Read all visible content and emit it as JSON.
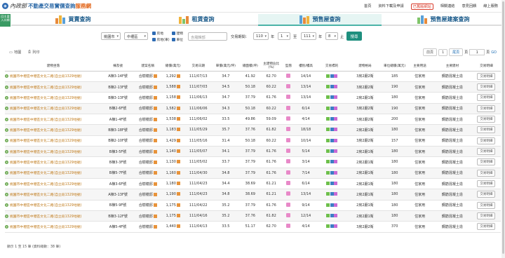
{
  "header": {
    "org": "內政部",
    "title_main": "不動產交易實價查詢",
    "title_accent": "服務網",
    "nav": [
      "首頁",
      "資料下載及申請",
      "已舊版網站",
      "相關連結",
      "意見回饋",
      "線上服務"
    ]
  },
  "sidetab": "回主要入口網",
  "tabs": [
    {
      "label": "買賣查詢",
      "active": false
    },
    {
      "label": "租賃查詢",
      "active": false
    },
    {
      "label": "預售屋查詢",
      "active": true
    },
    {
      "label": "預售屋建案查詢",
      "active": false
    }
  ],
  "search": {
    "city": "桃園市",
    "district": "中壢區",
    "checks": [
      "房地",
      "房地(車)",
      "建物",
      "車位"
    ],
    "keyword_placeholder": "含羅輯部",
    "period_label": "交易期間：",
    "from_year": "110",
    "year_unit": "年",
    "from_month": "1",
    "to_label": "至",
    "to_year": "111",
    "to_month": "8",
    "month_unit": "止",
    "submit": "搜尋"
  },
  "toolbar": {
    "map": "地圖",
    "print": "列印",
    "prev": "前頁",
    "next": "尾頁",
    "page_label": "頁",
    "page_value": "1",
    "page_total": "頁",
    "go": "GO"
  },
  "columns": [
    "建物坐落",
    "棟及號",
    "建案名稱",
    "總價(萬元)",
    "交易日期",
    "單價(萬元/坪)",
    "總面積(坪)",
    "主建物佔比(%)",
    "型態",
    "樓別/樓高",
    "交易標的",
    "建物格局",
    "車位總價(萬元)",
    "主要用途",
    "主要建材",
    "交易明細"
  ],
  "rows": [
    [
      "桃園市中壢區中壢區文化二路(自立段1329地號)",
      "A棟3-14F號",
      "合樹蘊邸",
      "1,292",
      "111/07/13",
      "34.7",
      "41.92",
      "62.70",
      "14/14",
      "3房2廳2衛",
      "185"
    ],
    [
      "桃園市中壢區中壢區文化二路(自立段1329地號)",
      "B棟2-13F號",
      "合樹蘊邸",
      "1,588",
      "111/07/03",
      "34.5",
      "50.18",
      "60.22",
      "13/14",
      "3房2廳2衛",
      "190"
    ],
    [
      "桃園市中壢區中壢區文化二路(自立段1329地號)",
      "B棟3-13F號",
      "合樹蘊邸",
      "1,158",
      "111/06/13",
      "34.7",
      "37.79",
      "61.76",
      "13/14",
      "2房2廳1衛",
      "180"
    ],
    [
      "桃園市中壢區中壢區文化二路(自立段1329地號)",
      "B棟2-6F號",
      "合樹蘊邸",
      "1,582",
      "111/06/06",
      "34.3",
      "50.18",
      "60.22",
      "6/14",
      "3房2廳2衛",
      "190"
    ],
    [
      "桃園市中壢區中壢區文化二路(自立段1329地號)",
      "A棟1-4F號",
      "合樹蘊邸",
      "1,538",
      "111/06/02",
      "33.5",
      "49.86",
      "59.09",
      "4/14",
      "3房2廳2衛",
      "200"
    ],
    [
      "桃園市中壢區中壢區文化二路(自立段1329地號)",
      "B棟3-18F號",
      "合樹蘊邸",
      "1,183",
      "111/05/29",
      "35.7",
      "37.76",
      "61.82",
      "18/18",
      "2房2廳1衛",
      "180"
    ],
    [
      "桃園市中壢區中壢區文化二路(自立段1329地號)",
      "B棟2-10F號",
      "合樹蘊邸",
      "1,429",
      "111/05/16",
      "31.4",
      "50.18",
      "60.22",
      "10/14",
      "3房2廳2衛",
      "157"
    ],
    [
      "桃園市中壢區中壢區文化二路(自立段1329地號)",
      "B棟3-5F號",
      "合樹蘊邸",
      "1,140",
      "111/05/07",
      "34.1",
      "37.79",
      "61.76",
      "5/14",
      "2房2廳1衛",
      "180"
    ],
    [
      "桃園市中壢區中壢區文化二路(自立段1329地號)",
      "B棟3-3F號",
      "合樹蘊邸",
      "1,130",
      "111/05/02",
      "33.7",
      "37.79",
      "61.76",
      "3/14",
      "2房2廳1衛",
      "180"
    ],
    [
      "桃園市中壢區中壢區文化二路(自立段1329地號)",
      "B棟5-7F號",
      "合樹蘊邸",
      "1,160",
      "111/04/30",
      "34.8",
      "37.79",
      "61.76",
      "7/14",
      "2房2廳1衛",
      "180"
    ],
    [
      "桃園市中壢區中壢區文化二路(自立段1329地號)",
      "A棟3-6F號",
      "合樹蘊邸",
      "1,180",
      "111/04/23",
      "34.4",
      "38.69",
      "61.21",
      "6/14",
      "2房2廳1衛",
      "180"
    ],
    [
      "桃園市中壢區中壢區文化二路(自立段1329地號)",
      "A棟3-13F號",
      "合樹蘊邸",
      "1,190",
      "111/04/23",
      "34.8",
      "38.69",
      "61.21",
      "13/14",
      "2房2廳1衛",
      "180"
    ],
    [
      "桃園市中壢區中壢區文化二路(自立段1329地號)",
      "B棟5-9F號",
      "合樹蘊邸",
      "1,175",
      "111/04/22",
      "35.2",
      "37.79",
      "61.76",
      "9/14",
      "2房2廳1衛",
      "180"
    ],
    [
      "桃園市中壢區中壢區文化二路(自立段1329地號)",
      "B棟3-12F號",
      "合樹蘊邸",
      "1,175",
      "111/04/16",
      "35.2",
      "37.76",
      "61.82",
      "12/14",
      "2房2廳1衛",
      "180"
    ],
    [
      "桃園市中壢區中壢區文化二路(自立段1329地號)",
      "A棟5-4F號",
      "合樹蘊邸",
      "1,440",
      "111/04/13",
      "33.5",
      "51.17",
      "62.70",
      "4/14",
      "3房2廳2衛",
      "370"
    ]
  ],
  "row_common": {
    "use": "住家用",
    "material": "鋼筋混凝土造",
    "detail": "交易明細"
  },
  "footer": "顯示 1 至 15 筆 (資料總數：38 筆)"
}
